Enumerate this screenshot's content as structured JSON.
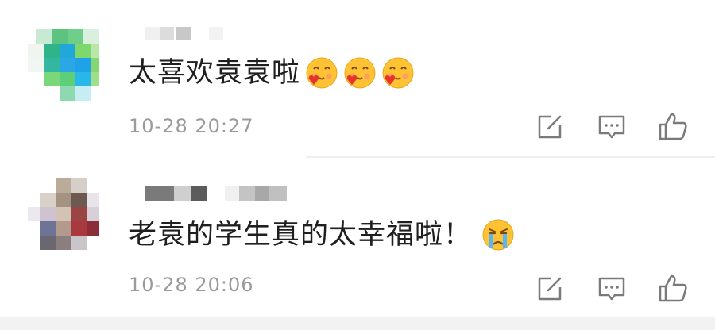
{
  "comments": [
    {
      "author": "",
      "text": "太喜欢袁袁啦",
      "emojis": [
        "heart-kiss-emoji",
        "heart-kiss-emoji",
        "heart-kiss-emoji"
      ],
      "timestamp": "10-28 20:27"
    },
    {
      "author": "",
      "text": "老袁的学生真的太幸福啦！",
      "emojis": [
        "crying-emoji"
      ],
      "timestamp": "10-28 20:06"
    }
  ],
  "actions": [
    "edit-icon",
    "reply-icon",
    "like-icon"
  ],
  "colors": {
    "text": "#1f1f1f",
    "meta": "#9a9a9a",
    "icon": "#7a7a7a",
    "divider": "#efefef",
    "emoji": "#ffc233",
    "heart": "#e8332a"
  }
}
